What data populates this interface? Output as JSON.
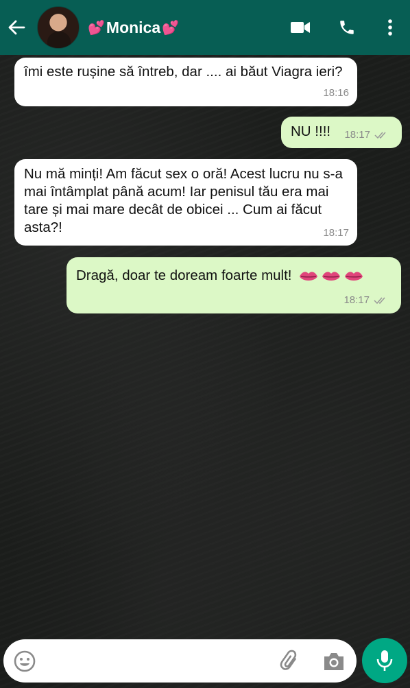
{
  "header": {
    "contact_name": "Monica",
    "heart_left": "💕",
    "heart_right": "💕",
    "icons": [
      "back-arrow-icon",
      "video-call-icon",
      "phone-icon",
      "more-options-icon"
    ],
    "bg_color": "#075e54"
  },
  "messages": [
    {
      "direction": "incoming",
      "text": "îmi este rușine să întreb, dar .... ai băut Viagra ieri?",
      "time": "18:16"
    },
    {
      "direction": "outgoing",
      "text": "NU !!!!",
      "time": "18:17",
      "status": "read"
    },
    {
      "direction": "incoming",
      "text": "Nu mă minți! Am făcut sex o oră! Acest lucru nu s-a mai întâmplat până acum! Iar penisul tău era mai tare și mai mare decât de obicei ... Cum ai făcut asta?!",
      "time": "18:17"
    },
    {
      "direction": "outgoing",
      "text": "Dragă, doar te doream foarte mult!",
      "emoji": "💋💋💋",
      "time": "18:17",
      "status": "read"
    }
  ],
  "input_bar": {
    "icons": [
      "emoji-icon",
      "attach-icon",
      "camera-icon",
      "mic-icon"
    ]
  },
  "colors": {
    "incoming_bubble": "#ffffff",
    "outgoing_bubble": "#dcf8c6",
    "mic_button": "#00a884"
  }
}
